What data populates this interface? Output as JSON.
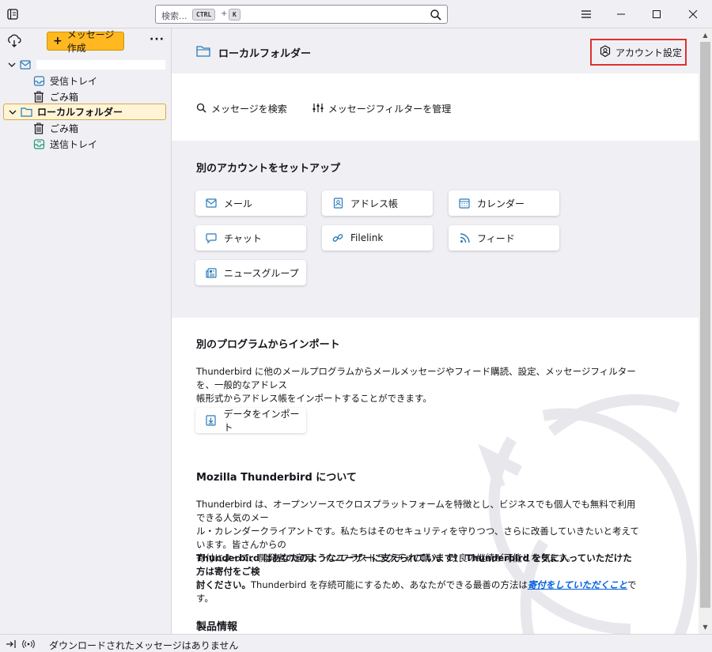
{
  "titlebar": {
    "search_placeholder": "検索...",
    "kbd_ctrl": "CTRL",
    "kbd_plus": "+",
    "kbd_k": "K"
  },
  "sidebar": {
    "compose_label": "メッセージ作成",
    "more_label": "···",
    "account_name": "",
    "folders": {
      "inbox": "受信トレイ",
      "trash1": "ごみ箱",
      "local_folders": "ローカルフォルダー",
      "trash2": "ごみ箱",
      "outbox": "送信トレイ"
    }
  },
  "main": {
    "folder_title": "ローカルフォルダー",
    "account_settings": "アカウント設定",
    "actions": {
      "search_messages": "メッセージを検索",
      "manage_filters": "メッセージフィルターを管理"
    },
    "setup": {
      "heading": "別のアカウントをセットアップ",
      "cards": {
        "mail": "メール",
        "addressbook": "アドレス帳",
        "calendar": "カレンダー",
        "chat": "チャット",
        "filelink": "Filelink",
        "feeds": "フィード",
        "newsgroups": "ニュースグループ"
      }
    },
    "import": {
      "heading": "別のプログラムからインポート",
      "line1": "Thunderbird に他のメールプログラムからメールメッセージやフィード購読、設定、メッセージフィルターを、一般的なアドレス",
      "line2": "帳形式からアドレス帳をインポートすることができます。",
      "button": "データをインポート"
    },
    "about": {
      "heading": "Mozilla Thunderbird について",
      "line1": "Thunderbird は、オープンソースでクロスプラットフォームを特徴とし、ビジネスでも個人でも無料で利用できる人気のメー",
      "line2": "ル・カレンダークライアントです。私たちはそのセキュリティを守りつつ、さらに改善していきたいと考えています。皆さんからの",
      "line3": "寄付によって、開発者の雇用、インフラストラクチャの購入、改良の継続が可能となります。",
      "bold1": "Thunderbird はあなたのようなユーザーに支えられています！ Thunderbird を気に入っていただけた方は寄付をご検",
      "bold2": "討ください。",
      "normal2": "Thunderbird を存続可能にするため、あなたができる最善の方法は",
      "link": "寄付をしていただくこと",
      "tail": "です。"
    },
    "product_heading": "製品情報"
  },
  "statusbar": {
    "text": "ダウンロードされたメッセージはありません"
  },
  "colors": {
    "accent_compose": "#ffb81f",
    "highlight_border": "#e03030",
    "icon_blue": "#2a7ab8"
  }
}
